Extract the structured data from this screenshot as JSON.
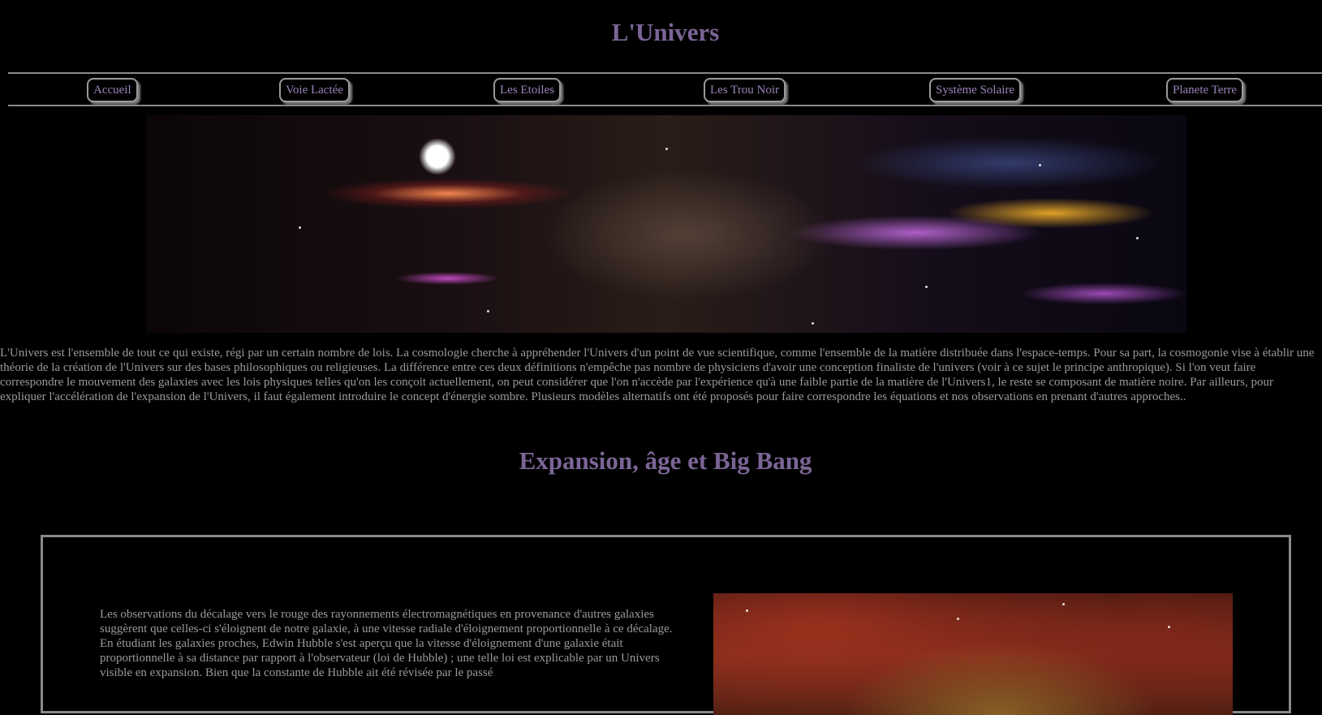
{
  "page": {
    "title": "L'Univers"
  },
  "nav": {
    "items": [
      {
        "label": "Accueil"
      },
      {
        "label": "Voie Lactée"
      },
      {
        "label": "Les Etoiles"
      },
      {
        "label": "Les Trou Noir"
      },
      {
        "label": "Système Solaire"
      },
      {
        "label": "Planete Terre"
      }
    ]
  },
  "intro": {
    "text": "L'Univers est l'ensemble de tout ce qui existe, régi par un certain nombre de lois. La cosmologie cherche à appréhender l'Univers d'un point de vue scientifique, comme l'ensemble de la matière distribuée dans l'espace-temps. Pour sa part, la cosmogonie vise à établir une théorie de la création de l'Univers sur des bases philosophiques ou religieuses. La différence entre ces deux définitions n'empêche pas nombre de physiciens d'avoir une conception finaliste de l'univers (voir à ce sujet le principe anthropique). Si l'on veut faire correspondre le mouvement des galaxies avec les lois physiques telles qu'on les conçoit actuellement, on peut considérer que l'on n'accède par l'expérience qu'à une faible partie de la matière de l'Univers1, le reste se composant de matière noire. Par ailleurs, pour expliquer l'accélération de l'expansion de l'Univers, il faut également introduire le concept d'énergie sombre. Plusieurs modèles alternatifs ont été proposés pour faire correspondre les équations et nos observations en prenant d'autres approches.."
  },
  "section": {
    "heading": "Expansion, âge et Big Bang",
    "text": "Les observations du décalage vers le rouge des rayonnements électromagnétiques en provenance d'autres galaxies suggèrent que celles-ci s'éloignent de notre galaxie, à une vitesse radiale d'éloignement proportionnelle à ce décalage. En étudiant les galaxies proches, Edwin Hubble s'est aperçu que la vitesse d'éloignement d'une galaxie était proportionnelle à sa distance par rapport à l'observateur (loi de Hubble) ; une telle loi est explicable par un Univers visible en expansion. Bien que la constante de Hubble ait été révisée par le passé"
  }
}
